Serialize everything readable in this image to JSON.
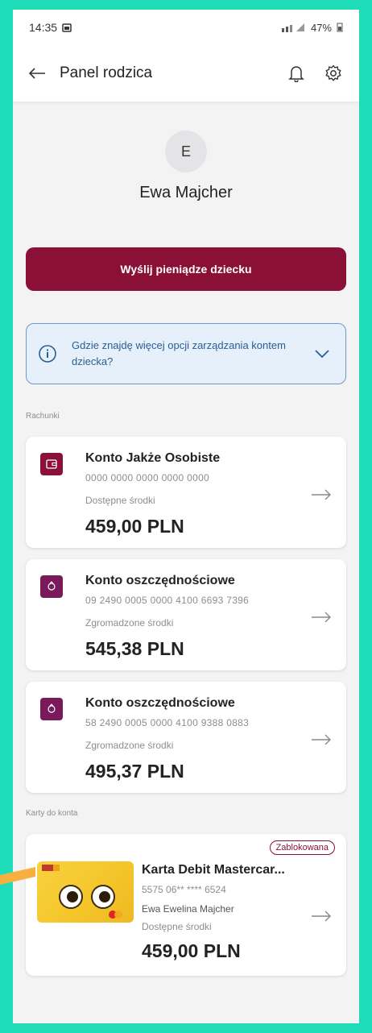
{
  "status": {
    "time": "14:35",
    "battery": "47%"
  },
  "header": {
    "title": "Panel rodzica"
  },
  "profile": {
    "initial": "E",
    "name": "Ewa Majcher"
  },
  "actions": {
    "send_money": "Wyślij pieniądze dziecku"
  },
  "info_banner": {
    "text": "Gdzie znajdę więcej opcji zarządzania kontem dziecka?"
  },
  "sections": {
    "accounts": "Rachunki",
    "cards": "Karty do konta"
  },
  "accounts": [
    {
      "name": "Konto Jakże Osobiste",
      "number": "0000 0000 0000 0000 0000",
      "label": "Dostępne środki",
      "amount": "459,00 PLN",
      "tile_color": "#8b1038",
      "icon": "wallet-icon"
    },
    {
      "name": "Konto oszczędnościowe",
      "number": "09 2490 0005 0000 4100 6693 7396",
      "label": "Zgromadzone środki",
      "amount": "545,38 PLN",
      "tile_color": "#7a1a5c",
      "icon": "piggy-bank-icon"
    },
    {
      "name": "Konto oszczędnościowe",
      "number": "58 2490 0005 0000 4100 9388 0883",
      "label": "Zgromadzone środki",
      "amount": "495,37 PLN",
      "tile_color": "#7a1a5c",
      "icon": "piggy-bank-icon"
    }
  ],
  "card": {
    "badge": "Zablokowana",
    "name": "Karta Debit Mastercar...",
    "number": "5575 06** **** 6524",
    "holder": "Ewa Ewelina Majcher",
    "label": "Dostępne środki",
    "amount": "459,00 PLN"
  },
  "colors": {
    "accent": "#8b1038",
    "background": "#1fdcb8",
    "info_bg": "#e6f0fb",
    "info_text": "#2a5d93"
  }
}
